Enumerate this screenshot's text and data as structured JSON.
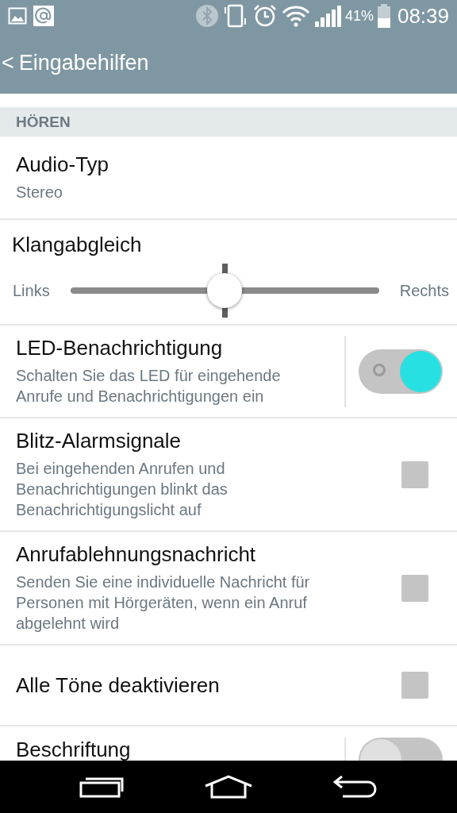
{
  "status_bar": {
    "battery_text": "41%",
    "time": "08:39"
  },
  "app_bar": {
    "back": "<",
    "title": "Eingabehilfen"
  },
  "section": {
    "title": "HÖREN"
  },
  "rows": [
    {
      "kind": "detail",
      "title": "Audio-Typ",
      "summary": "Stereo"
    },
    {
      "kind": "slider",
      "title": "Klangabgleich",
      "left": "Links",
      "right": "Rechts",
      "level": 0.5
    },
    {
      "kind": "switch",
      "title": "LED-Benachrichtigung",
      "summary": "Schalten Sie das LED für eingehende Anrufe und Benachrichtigungen ein",
      "on": true
    },
    {
      "kind": "checkbox",
      "title": "Blitz-Alarmsignale",
      "summary": "Bei eingehenden Anrufen und Benachrichtigungen blinkt das Benachrichtigungslicht auf",
      "checked": false
    },
    {
      "kind": "checkbox",
      "title": "Anrufablehnungsnachricht",
      "summary": "Senden Sie eine individuelle Nachricht für Personen mit Hörgeräten, wenn ein Anruf abgelehnt wird",
      "checked": false
    },
    {
      "kind": "checkbox",
      "title": "Alle Töne deaktivieren",
      "checked": false
    },
    {
      "kind": "switch",
      "title": "Beschriftung",
      "on": false
    }
  ]
}
